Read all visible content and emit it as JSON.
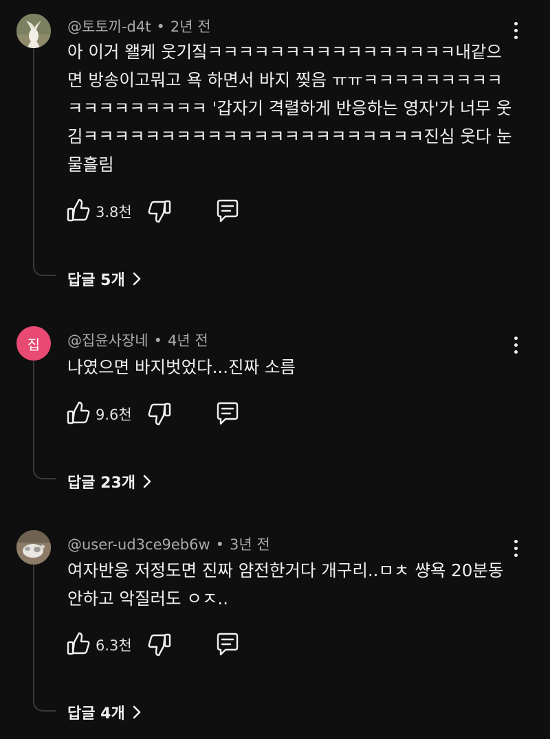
{
  "comments": [
    {
      "author": "@토토끼-d4t",
      "separator": "•",
      "time": "2년 전",
      "text": "아 이거 왤케 웃기짘ㅋㅋㅋㅋㅋㅋㅋㅋㅋㅋㅋㅋㅋㅋㅋㅋ내같으면 방송이고뭐고 욕 하면서 바지 찢음 ㅠㅠㅋㅋㅋㅋㅋㅋㅋㅋㅋㅋㅋㅋㅋㅋㅋㅋㅋㅋ '갑자기 격렬하게 반응하는 영자'가 너무 웃김ㅋㅋㅋㅋㅋㅋㅋㅋㅋㅋㅋㅋㅋㅋㅋㅋㅋㅋㅋㅋㅋㅋ진심 웃다 눈물흘림",
      "likes": "3.8천",
      "replies_label": "답글 5개",
      "avatar_icon": "goat-avatar"
    },
    {
      "author": "@집윤사장네",
      "separator": "•",
      "time": "4년 전",
      "text": "나였으면 바지벗었다...진짜 소름",
      "likes": "9.6천",
      "replies_label": "답글 23개",
      "avatar_initial": "집",
      "avatar_color": "#e84a73"
    },
    {
      "author": "@user-ud3ce9eb6w",
      "separator": "•",
      "time": "3년 전",
      "text": "여자반응 저정도면 진짜 얌전한거다 개구리..ㅁㅊ 썅욕 20분동안하고 악질러도 ㅇㅈ..",
      "likes": "6.3천",
      "replies_label": "답글 4개",
      "avatar_icon": "animal-photo-avatar"
    }
  ],
  "icons": {
    "like": "thumbs-up-icon",
    "dislike": "thumbs-down-icon",
    "reply": "reply-bubble-icon",
    "more": "more-vertical-icon",
    "chevron": "chevron-right-icon"
  }
}
